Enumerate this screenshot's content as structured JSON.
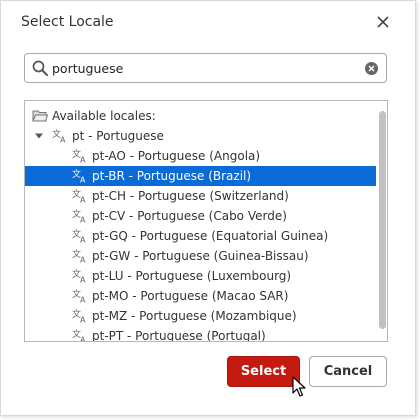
{
  "dialog": {
    "title": "Select Locale",
    "close_icon": "close-icon"
  },
  "search": {
    "value": "portuguese",
    "search_icon": "search-icon",
    "clear_icon": "clear-icon"
  },
  "tree": {
    "root_label": "Available locales:",
    "root_icon": "folder-open-icon",
    "group": {
      "label": "pt - Portuguese",
      "icon": "translate-icon",
      "expanded": true
    },
    "items": [
      {
        "label": "pt-AO - Portuguese (Angola)",
        "selected": false
      },
      {
        "label": "pt-BR - Portuguese (Brazil)",
        "selected": true
      },
      {
        "label": "pt-CH - Portuguese (Switzerland)",
        "selected": false
      },
      {
        "label": "pt-CV - Portuguese (Cabo Verde)",
        "selected": false
      },
      {
        "label": "pt-GQ - Portuguese (Equatorial Guinea)",
        "selected": false
      },
      {
        "label": "pt-GW - Portuguese (Guinea-Bissau)",
        "selected": false
      },
      {
        "label": "pt-LU - Portuguese (Luxembourg)",
        "selected": false
      },
      {
        "label": "pt-MO - Portuguese (Macao SAR)",
        "selected": false
      },
      {
        "label": "pt-MZ - Portuguese (Mozambique)",
        "selected": false
      },
      {
        "label": "pt-PT - Portuguese (Portugal)",
        "selected": false
      }
    ]
  },
  "buttons": {
    "select_label": "Select",
    "cancel_label": "Cancel"
  },
  "colors": {
    "selection": "#0a6ad6",
    "primary_button": "#c41a0f"
  }
}
